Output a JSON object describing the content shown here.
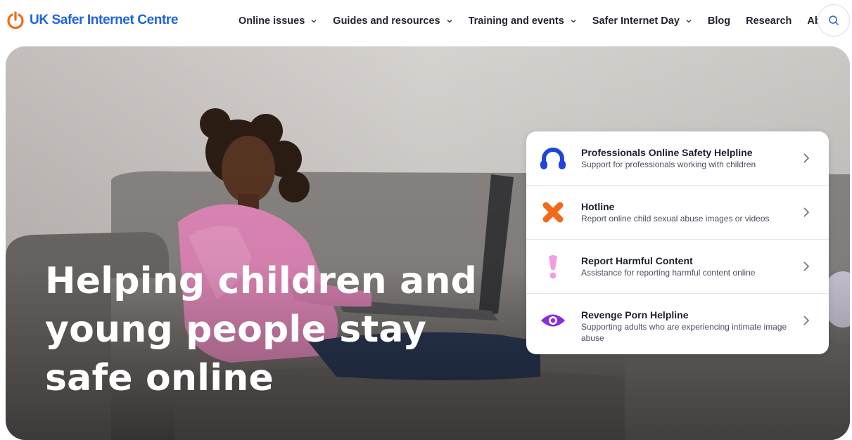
{
  "header": {
    "logo_text": "UK Safer Internet Centre",
    "nav": [
      {
        "label": "Online issues",
        "has_dropdown": true
      },
      {
        "label": "Guides and resources",
        "has_dropdown": true
      },
      {
        "label": "Training and events",
        "has_dropdown": true
      },
      {
        "label": "Safer Internet Day",
        "has_dropdown": true
      },
      {
        "label": "Blog",
        "has_dropdown": false
      },
      {
        "label": "Research",
        "has_dropdown": false
      },
      {
        "label": "About",
        "has_dropdown": false
      }
    ],
    "search_icon": "search-icon"
  },
  "hero": {
    "title_lines": [
      "Helping children and",
      "young people stay",
      "safe online"
    ]
  },
  "services": [
    {
      "title": "Professionals Online Safety Helpline",
      "subtitle": "Support for professionals working with children",
      "icon": "headset-icon",
      "color": "#1f44d8"
    },
    {
      "title": "Hotline",
      "subtitle": "Report online child sexual abuse images or videos",
      "icon": "cross-icon",
      "color": "#f06a1a"
    },
    {
      "title": "Report Harmful Content",
      "subtitle": "Assistance for reporting harmful content online",
      "icon": "exclamation-icon",
      "color": "#f39ee0"
    },
    {
      "title": "Revenge Porn Helpline",
      "subtitle": "Supporting adults who are experiencing intimate image abuse",
      "icon": "eye-icon",
      "color": "#8a2be2"
    }
  ],
  "colors": {
    "brand_blue": "#1e63e0",
    "brand_orange": "#f06a1a",
    "nav_text": "#1f2330"
  }
}
